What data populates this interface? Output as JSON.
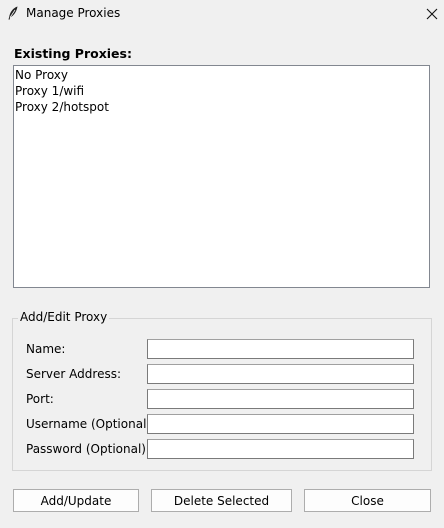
{
  "window": {
    "title": "Manage Proxies",
    "app_icon": "feather-icon",
    "close_icon": "close-icon"
  },
  "proxies_section": {
    "label": "Existing Proxies:",
    "items": [
      "No Proxy",
      "Proxy 1/wifi",
      "Proxy 2/hotspot"
    ]
  },
  "form": {
    "group_title": "Add/Edit Proxy",
    "fields": {
      "name": {
        "label": "Name:",
        "value": ""
      },
      "server": {
        "label": "Server Address:",
        "value": ""
      },
      "port": {
        "label": "Port:",
        "value": ""
      },
      "username": {
        "label": "Username (Optional):",
        "value": ""
      },
      "password": {
        "label": "Password (Optional):",
        "value": ""
      }
    }
  },
  "buttons": {
    "add_update": "Add/Update",
    "delete_selected": "Delete Selected",
    "close": "Close"
  }
}
